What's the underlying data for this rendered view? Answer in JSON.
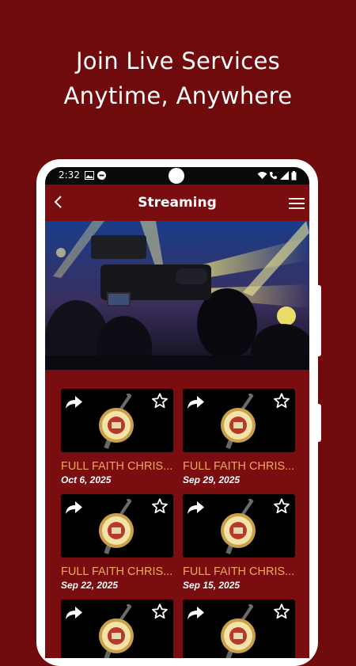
{
  "promo": {
    "line1": "Join Live Services",
    "line2": "Anytime, Anywhere"
  },
  "statusbar": {
    "time": "2:32"
  },
  "appbar": {
    "title": "Streaming"
  },
  "videos": [
    {
      "title": "FULL FAITH CHRIS...",
      "date": "Oct 6, 2025"
    },
    {
      "title": "FULL FAITH CHRIS...",
      "date": "Sep 29, 2025"
    },
    {
      "title": "FULL FAITH CHRIS...",
      "date": "Sep 22, 2025"
    },
    {
      "title": "FULL FAITH CHRIS...",
      "date": "Sep 15, 2025"
    },
    {
      "title": "",
      "date": ""
    },
    {
      "title": "",
      "date": ""
    }
  ],
  "colors": {
    "brand": "#6f0a0d",
    "title_accent": "#f2a65c",
    "logo_gold": "#c9a14a"
  },
  "icons": [
    "back-chevron-icon",
    "hamburger-menu-icon",
    "share-icon",
    "star-outline-icon",
    "wifi-icon",
    "signal-icon",
    "battery-icon"
  ]
}
